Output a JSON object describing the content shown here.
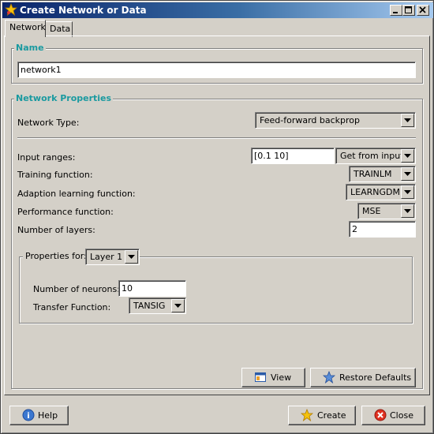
{
  "window": {
    "title": "Create Network or Data"
  },
  "tabs": [
    {
      "label": "Network",
      "active": true
    },
    {
      "label": "Data",
      "active": false
    }
  ],
  "name_section": {
    "title": "Name",
    "value": "network1"
  },
  "properties": {
    "title": "Network Properties",
    "network_type_label": "Network Type:",
    "network_type_value": "Feed-forward backprop",
    "input_ranges_label": "Input ranges:",
    "input_ranges_value": "[0.1 10]",
    "get_from_input_value": "Get from input:",
    "training_function_label": "Training function:",
    "training_function_value": "TRAINLM",
    "adaption_function_label": "Adaption learning function:",
    "adaption_function_value": "LEARNGDM",
    "performance_function_label": "Performance function:",
    "performance_function_value": "MSE",
    "num_layers_label": "Number of layers:",
    "num_layers_value": "2"
  },
  "layer_properties": {
    "properties_for_label": "Properties for:",
    "layer_value": "Layer 1",
    "num_neurons_label": "Number of neurons:",
    "num_neurons_value": "10",
    "transfer_function_label": "Transfer Function:",
    "transfer_function_value": "TANSIG"
  },
  "buttons": {
    "view": "View",
    "restore_defaults": "Restore Defaults",
    "help": "Help",
    "create": "Create",
    "close": "Close"
  },
  "colors": {
    "section_title": "#1a9aa0",
    "titlebar_start": "#0a246a",
    "titlebar_end": "#a6caf0",
    "face": "#d4d0c8"
  },
  "icons": {
    "app": "star-icon",
    "view": "view-window-icon",
    "restore": "star-icon",
    "help": "help-icon",
    "create": "star-icon",
    "close": "close-circle-icon"
  }
}
